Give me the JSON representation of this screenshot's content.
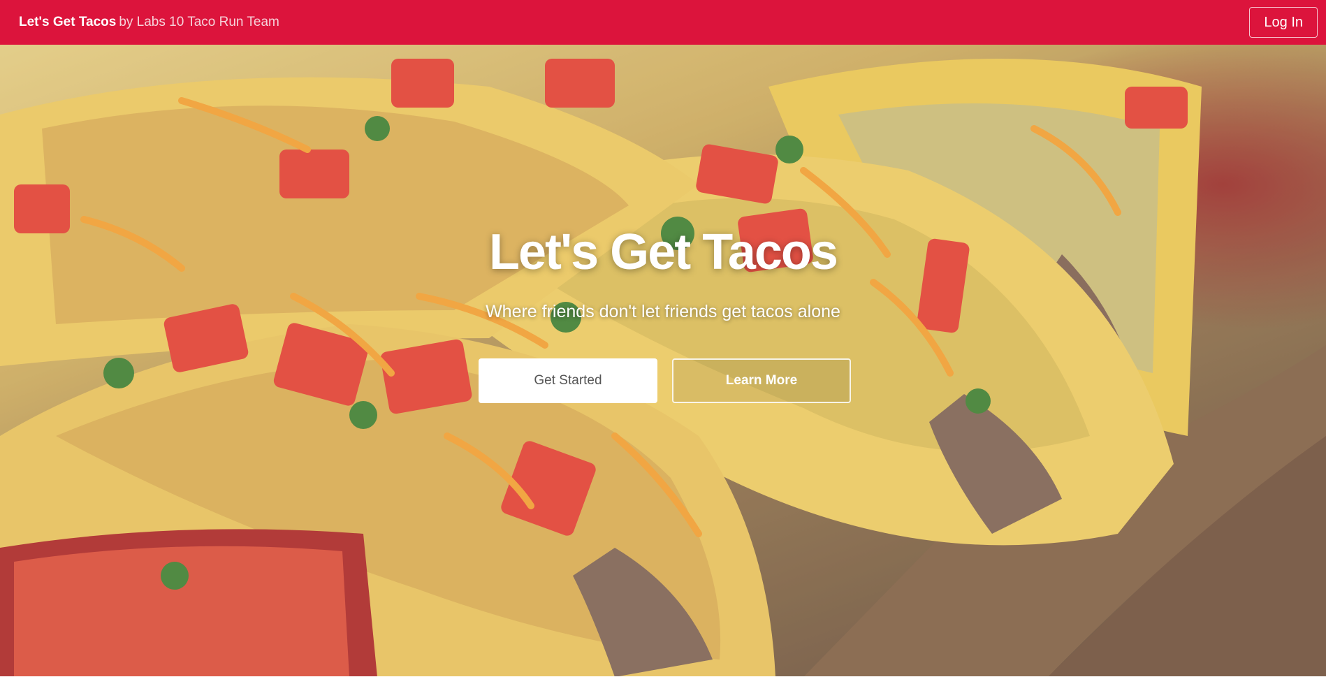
{
  "navbar": {
    "brand_name": "Let's Get Tacos",
    "brand_team": "by Labs 10 Taco Run Team",
    "login_label": "Log In",
    "color": "#dc143c"
  },
  "hero": {
    "title": "Let's Get Tacos",
    "subtitle": "Where friends don't let friends get tacos alone",
    "primary_button": "Get Started",
    "secondary_button": "Learn More",
    "background_image": "tacos-photo"
  }
}
